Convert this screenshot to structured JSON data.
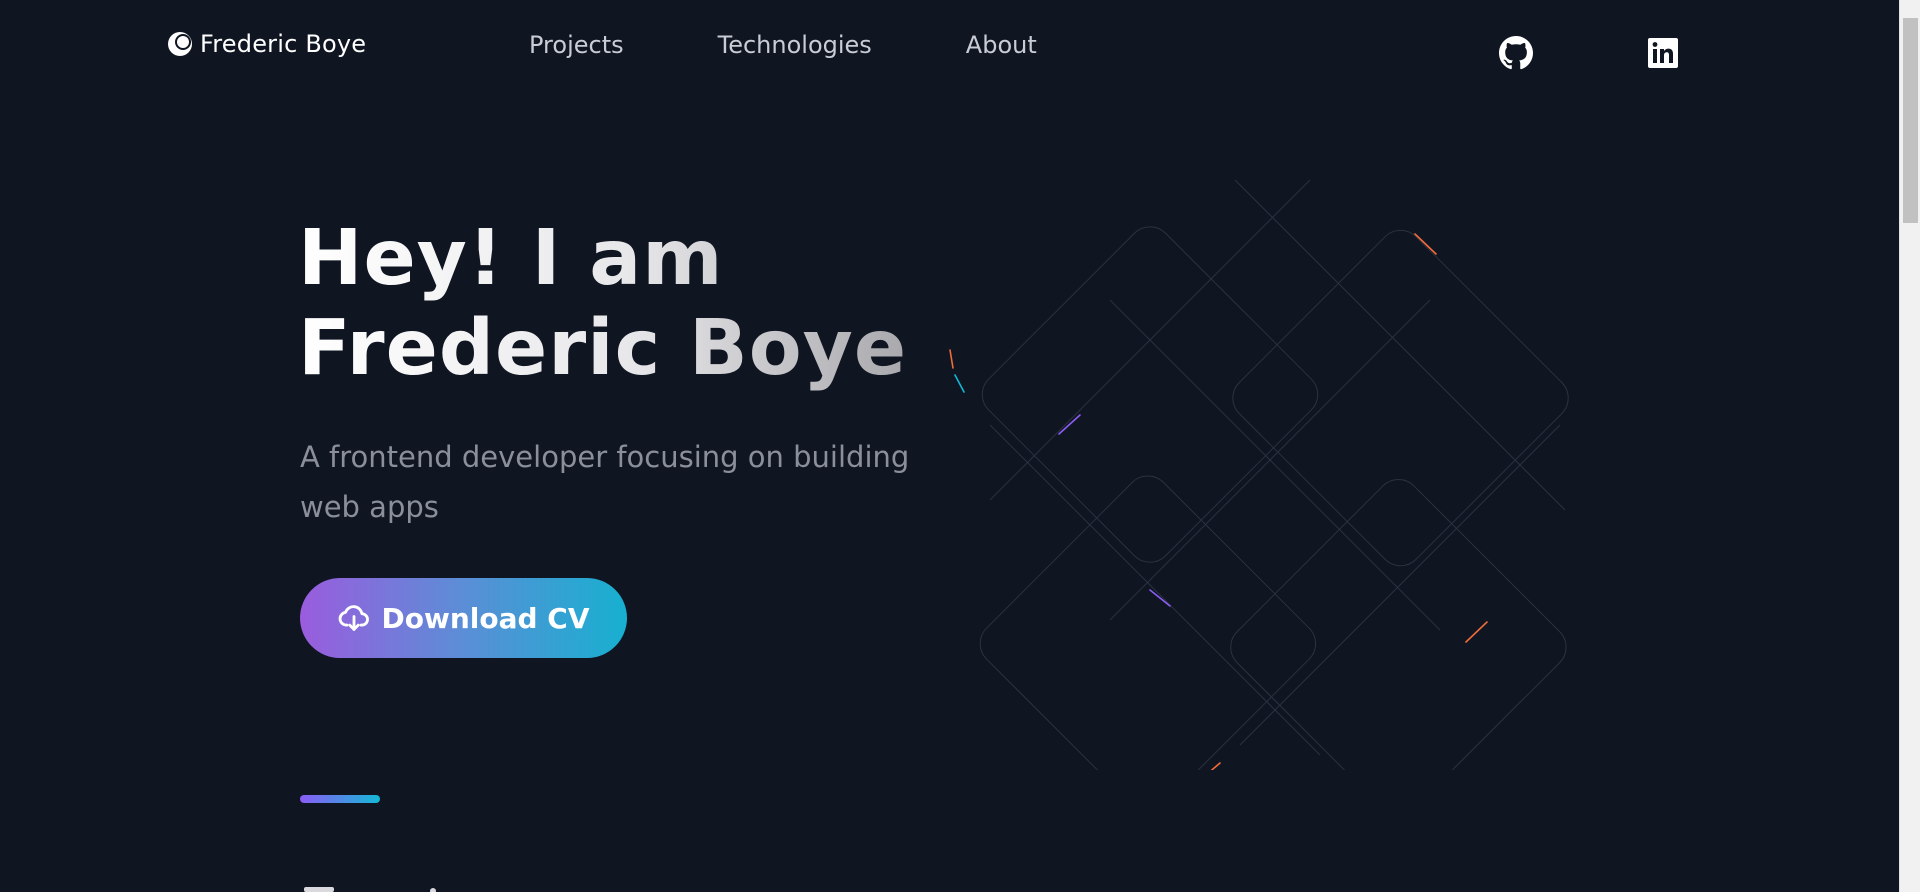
{
  "header": {
    "logo_text": "Frederic Boye",
    "logo_icon": "crescent-logo-icon",
    "nav": [
      {
        "label": "Projects"
      },
      {
        "label": "Technologies"
      },
      {
        "label": "About"
      }
    ],
    "social": [
      {
        "icon": "github-icon"
      },
      {
        "icon": "linkedin-icon"
      }
    ]
  },
  "hero": {
    "title_line1": "Hey! I am",
    "title_line2": "Frederic Boye",
    "subtitle": "A frontend developer focusing on building web apps",
    "cv_button_label": "Download CV",
    "cv_button_icon": "cloud-download-icon"
  },
  "colors": {
    "background": "#0f1521",
    "button_gradient_start": "#9a5cde",
    "button_gradient_end": "#17b0d0",
    "nav_text": "#c9ccd4",
    "subtitle_text": "#8b8f99"
  }
}
